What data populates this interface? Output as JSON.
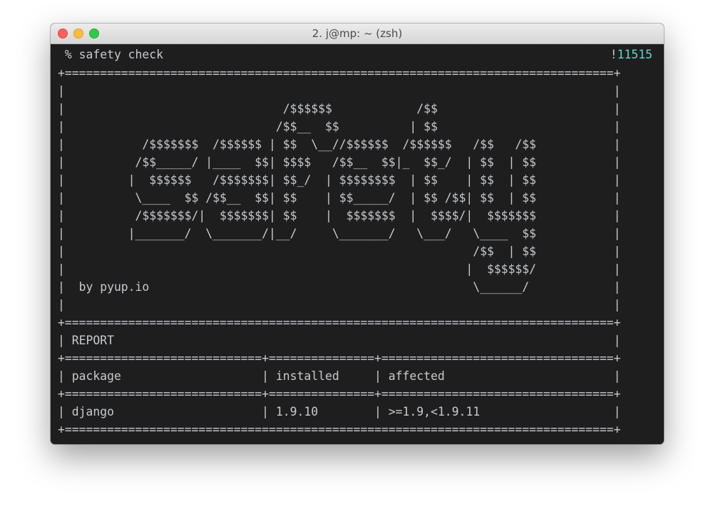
{
  "window": {
    "title": "2. j@mp: ~ (zsh)"
  },
  "prompt": {
    "command": " % safety check",
    "bang": "!",
    "history_number": "11515"
  },
  "banner_lines": [
    "+==============================================================================+",
    "|                                                                              |",
    "|                               /$$$$$$            /$$                         |",
    "|                              /$$__  $$          | $$                         |",
    "|           /$$$$$$$  /$$$$$$ | $$  \\__//$$$$$$  /$$$$$$   /$$   /$$           |",
    "|          /$$_____/ |____  $$| $$$$   /$$__  $$|_  $$_/  | $$  | $$           |",
    "|         |  $$$$$$   /$$$$$$$| $$_/  | $$$$$$$$  | $$    | $$  | $$           |",
    "|          \\____  $$ /$$__  $$| $$    | $$_____/  | $$ /$$| $$  | $$           |",
    "|          /$$$$$$$/|  $$$$$$$| $$    |  $$$$$$$  |  $$$$/|  $$$$$$$           |",
    "|         |_______/  \\_______/|__/     \\_______/   \\___/   \\____  $$           |",
    "|                                                          /$$  | $$           |",
    "|                                                         |  $$$$$$/           |",
    "|  by pyup.io                                              \\______/            |",
    "|                                                                              |",
    "+==============================================================================+",
    "| REPORT                                                                       |",
    "+============================+===============+=================================+",
    "| package                    | installed     | affected                        |",
    "+============================+===============+=================================+",
    "| django                     | 1.9.10        | >=1.9,<1.9.11                   |",
    "+==============================================================================+"
  ]
}
